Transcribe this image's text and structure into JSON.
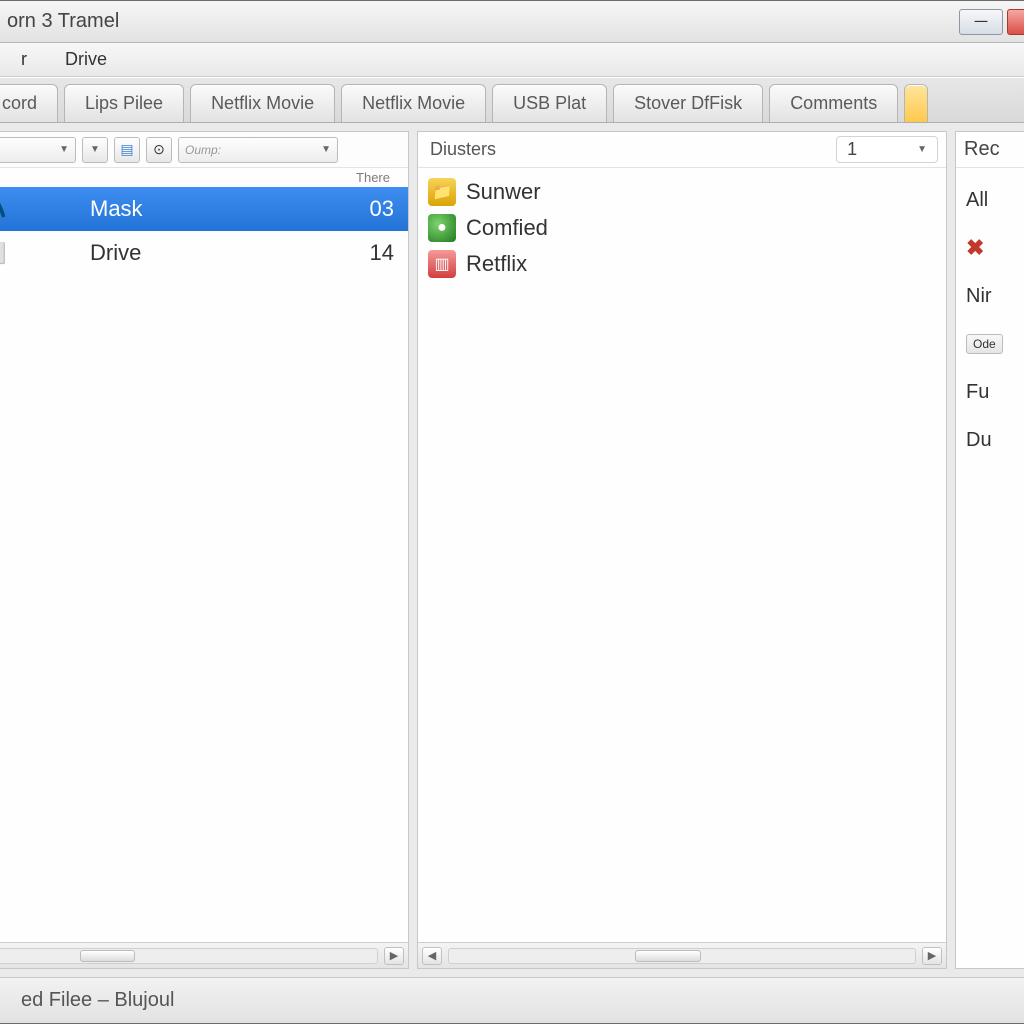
{
  "window": {
    "title": "orn 3 Tramel"
  },
  "menubar": {
    "items": [
      "r",
      "Drive"
    ]
  },
  "tabs": [
    "cord",
    "Lips Pilee",
    "Netflix Movie",
    "Netflix Movie",
    "USB Plat",
    "Stover DfFisk",
    "Comments"
  ],
  "left_panel": {
    "toolbar": {
      "combo1_label": "",
      "combo2_label": "Oump:"
    },
    "column_header": "There",
    "rows": [
      {
        "icon": "🧥",
        "name": "Mask",
        "value": "03",
        "selected": true
      },
      {
        "icon": "⬜",
        "name": "Drive",
        "value": "14",
        "selected": false
      }
    ]
  },
  "mid_panel": {
    "title": "Diusters",
    "selector_value": "1",
    "items": [
      {
        "name": "Sunwer"
      },
      {
        "name": "Comfied"
      },
      {
        "name": "Retflix"
      }
    ]
  },
  "right_panel": {
    "title": "Rec",
    "lines": {
      "l0": "All",
      "l1": "",
      "l2": "Nir",
      "l3_btn": "Ode",
      "l4": "Fu",
      "l5": "Du"
    }
  },
  "status": {
    "text": "ed Filee – Blujoul"
  }
}
